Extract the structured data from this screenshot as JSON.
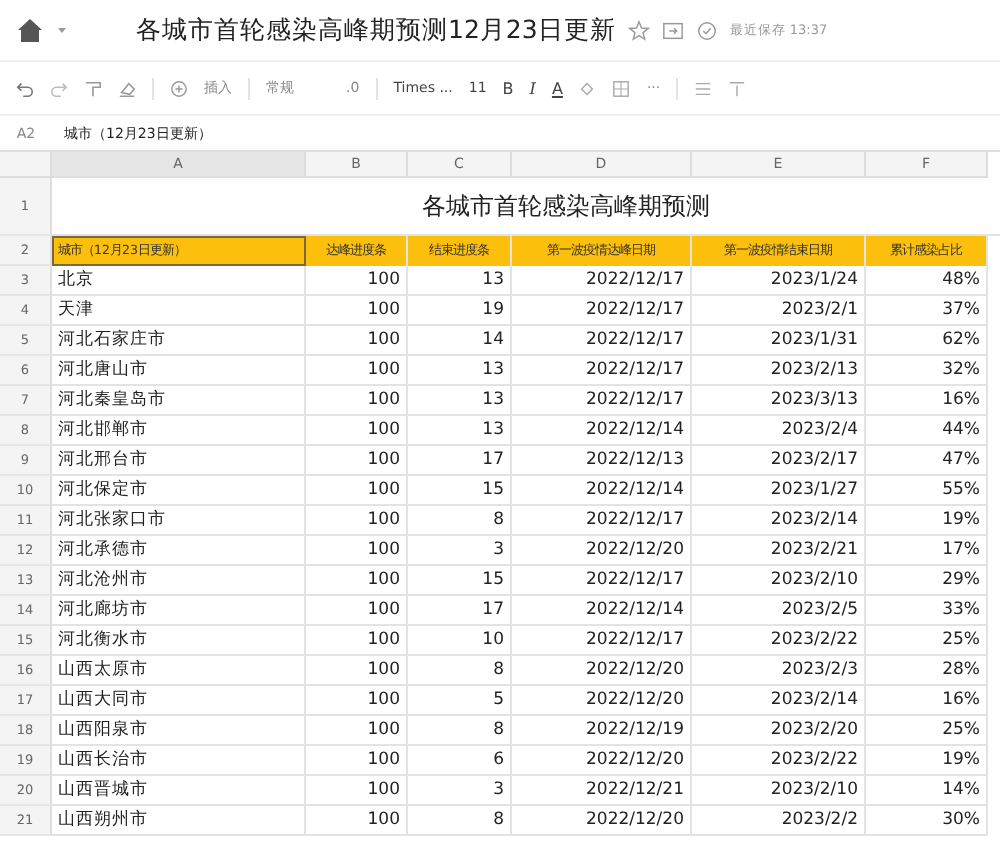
{
  "document": {
    "title": "各城市首轮感染高峰期预测12月23日更新",
    "save_status": "最近保存 13:37"
  },
  "toolbar": {
    "insert_label": "插入",
    "number_format": "常规",
    "decimal": ".0",
    "font": "Times ...",
    "font_size": "11",
    "bold": "B",
    "italic": "I",
    "font_color": "A",
    "more": "···"
  },
  "formula_bar": {
    "cell_ref": "A2",
    "value": "城市（12月23日更新）"
  },
  "sheet": {
    "columns": [
      "A",
      "B",
      "C",
      "D",
      "E",
      "F"
    ],
    "title_row": {
      "number": "1",
      "text": "各城市首轮感染高峰期预测"
    },
    "header_row": {
      "number": "2",
      "cells": [
        {
          "text": "城市（12月23日更新）",
          "selected": true
        },
        {
          "text": "达峰进度条",
          "selected": false
        },
        {
          "text": "结束进度条",
          "selected": false
        },
        {
          "text": "第一波疫情达峰日期",
          "selected": false
        },
        {
          "text": "第一波疫情结束日期",
          "selected": false
        },
        {
          "text": "累计感染占比",
          "selected": false
        }
      ]
    },
    "rows": [
      {
        "number": "3",
        "cells": [
          "北京",
          "100",
          "13",
          "2022/12/17",
          "2023/1/24",
          "48%"
        ]
      },
      {
        "number": "4",
        "cells": [
          "天津",
          "100",
          "19",
          "2022/12/17",
          "2023/2/1",
          "37%"
        ]
      },
      {
        "number": "5",
        "cells": [
          "河北石家庄市",
          "100",
          "14",
          "2022/12/17",
          "2023/1/31",
          "62%"
        ]
      },
      {
        "number": "6",
        "cells": [
          "河北唐山市",
          "100",
          "13",
          "2022/12/17",
          "2023/2/13",
          "32%"
        ]
      },
      {
        "number": "7",
        "cells": [
          "河北秦皇岛市",
          "100",
          "13",
          "2022/12/17",
          "2023/3/13",
          "16%"
        ]
      },
      {
        "number": "8",
        "cells": [
          "河北邯郸市",
          "100",
          "13",
          "2022/12/14",
          "2023/2/4",
          "44%"
        ]
      },
      {
        "number": "9",
        "cells": [
          "河北邢台市",
          "100",
          "17",
          "2022/12/13",
          "2023/2/17",
          "47%"
        ]
      },
      {
        "number": "10",
        "cells": [
          "河北保定市",
          "100",
          "15",
          "2022/12/14",
          "2023/1/27",
          "55%"
        ]
      },
      {
        "number": "11",
        "cells": [
          "河北张家口市",
          "100",
          "8",
          "2022/12/17",
          "2023/2/14",
          "19%"
        ]
      },
      {
        "number": "12",
        "cells": [
          "河北承德市",
          "100",
          "3",
          "2022/12/20",
          "2023/2/21",
          "17%"
        ]
      },
      {
        "number": "13",
        "cells": [
          "河北沧州市",
          "100",
          "15",
          "2022/12/17",
          "2023/2/10",
          "29%"
        ]
      },
      {
        "number": "14",
        "cells": [
          "河北廊坊市",
          "100",
          "17",
          "2022/12/14",
          "2023/2/5",
          "33%"
        ]
      },
      {
        "number": "15",
        "cells": [
          "河北衡水市",
          "100",
          "10",
          "2022/12/17",
          "2023/2/22",
          "25%"
        ]
      },
      {
        "number": "16",
        "cells": [
          "山西太原市",
          "100",
          "8",
          "2022/12/20",
          "2023/2/3",
          "28%"
        ]
      },
      {
        "number": "17",
        "cells": [
          "山西大同市",
          "100",
          "5",
          "2022/12/20",
          "2023/2/14",
          "16%"
        ]
      },
      {
        "number": "18",
        "cells": [
          "山西阳泉市",
          "100",
          "8",
          "2022/12/19",
          "2023/2/20",
          "25%"
        ]
      },
      {
        "number": "19",
        "cells": [
          "山西长治市",
          "100",
          "6",
          "2022/12/20",
          "2023/2/22",
          "19%"
        ]
      },
      {
        "number": "20",
        "cells": [
          "山西晋城市",
          "100",
          "3",
          "2022/12/21",
          "2023/2/10",
          "14%"
        ]
      },
      {
        "number": "21",
        "cells": [
          "山西朔州市",
          "100",
          "8",
          "2022/12/20",
          "2023/2/2",
          "30%"
        ]
      }
    ]
  }
}
